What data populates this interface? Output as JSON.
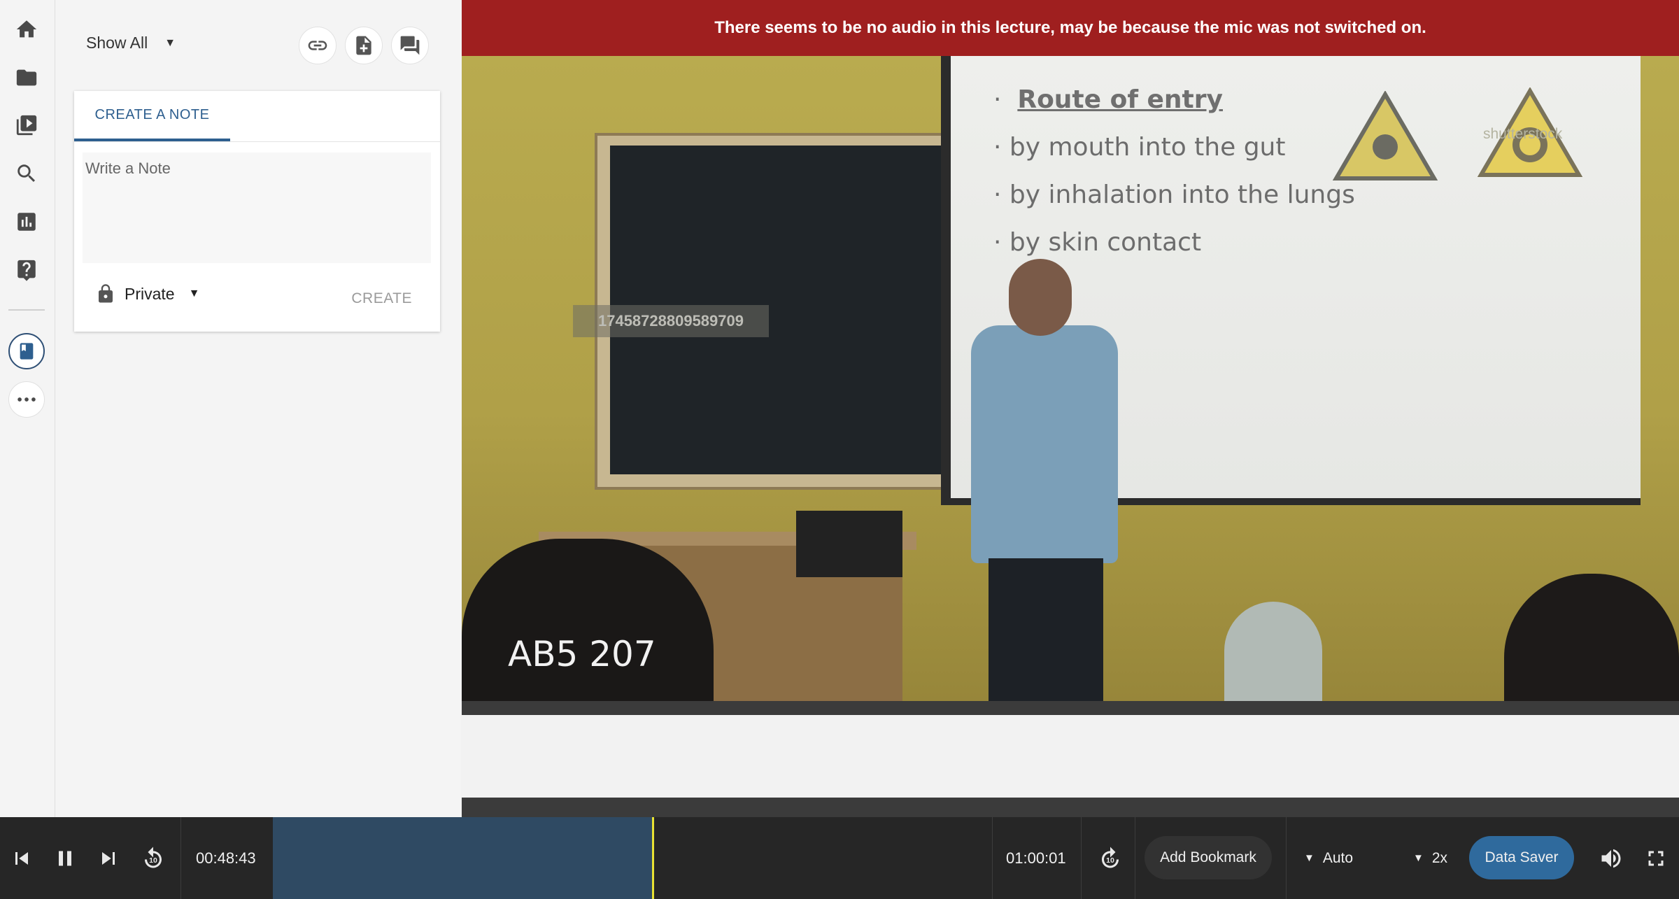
{
  "banner": {
    "message": "There seems to be no audio in this lecture, may be because the mic was not switched on."
  },
  "rail": {
    "icons": [
      "home-icon",
      "folder-icon",
      "video-library-icon",
      "search-icon",
      "bar-chart-icon",
      "help-icon",
      "notebook-icon",
      "more-icon"
    ],
    "active": "notebook-icon"
  },
  "notes": {
    "filter_label": "Show All",
    "toolbar_icons": [
      "link-icon",
      "add-document-icon",
      "comments-icon"
    ],
    "tab_label": "CREATE A NOTE",
    "textarea_placeholder": "Write a Note",
    "privacy_label": "Private",
    "create_label": "CREATE"
  },
  "video": {
    "board_id": "17458728809589709",
    "room_label": "AB5 207",
    "slide": {
      "heading": "Route of entry",
      "bullets": [
        "by mouth into the gut",
        "by inhalation into the lungs",
        "by skin contact"
      ],
      "image_label": "shutterstock"
    }
  },
  "controls": {
    "current_time": "00:48:43",
    "total_time": "01:00:01",
    "progress_fraction": 0.527,
    "add_bookmark_label": "Add Bookmark",
    "quality_label": "Auto",
    "speed_label": "2x",
    "data_saver_label": "Data Saver",
    "skip_seconds": "10"
  },
  "colors": {
    "banner": "#9f1f1f",
    "accent": "#2e5f8f",
    "control_bar": "#262626",
    "timeline_played": "#2f4a63",
    "playhead": "#e8e233",
    "data_saver": "#2f6a9d"
  }
}
